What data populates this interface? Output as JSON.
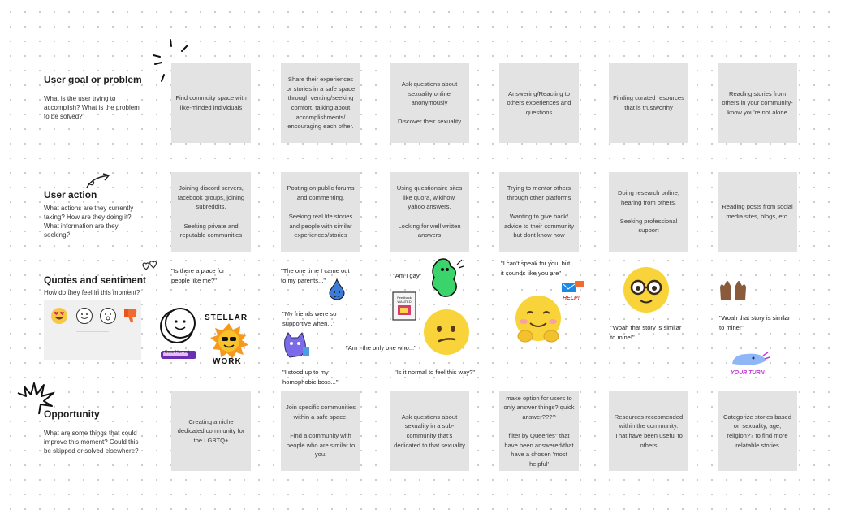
{
  "rows": {
    "goal": {
      "title": "User goal or problem",
      "desc": "What is the user trying to accomplish? What is the problem to be solved?"
    },
    "action": {
      "title": "User action",
      "desc": "What actions are they currently taking? How are they doing it? What information are they seeking?"
    },
    "quotes": {
      "title": "Quotes and sentiment",
      "desc": "How do they feel in this moment?"
    },
    "opportunity": {
      "title": "Opportunity",
      "desc": "What are some things that could improve this moment? Could this be skipped or solved elsewhere?"
    }
  },
  "goal_cards": [
    "Find commuity space with like-minded individuals",
    "Share their experiences or stories in a safe space through venting/seeking comfort, talking about accomplishments/ encouraging each other.",
    "Ask questions about sexuality online anonymously\n\nDiscover their sexuality",
    "Answering/Reacting to others experiences and questions",
    "Finding curated resources that is trustworthy",
    "Reading stories from others in your community- know you're not alone"
  ],
  "action_cards": [
    "Joining discord servers, facebook groups, joining subreddits.\n\nSeeking private and reputable communities",
    "Posting on public forums and commenting.\n\nSeeking real life stories and people with similar experiences/stories",
    "Using questionaire sites like quora, wikihow, yahoo answers.\n\nLooking for well written answers",
    "Trying to mentor others through other platforms\n\nWanting to give back/ advice to their community but dont know how",
    "Doing research online, hearing from others,\n\nSeeking professional support",
    "Reading posts from social media sites, blogs, etc."
  ],
  "opportunity_cards": [
    "Creating a niche dedicated community for the LGBTQ+",
    "Join specific communities within a safe space.\n\nFind a community with people who are similar to you.",
    "Ask questions about sexuality in a sub-community that's dedicated to that sexuality",
    "make option for users to only answer things? quick answer????\n\nfilter by Queeries'' that have been answered/that have a chosen 'most helpful'",
    "Resources reccomended within the community. That have been useful to others",
    "Categorize stories based on sexuality, age, religion?? to find more relatable stories"
  ],
  "quotes": {
    "q1": "\"Is there a place for\npeople like me?\"",
    "q2": "\"The one time I came out\nto my parents...\"",
    "q3": "\"My friends were so\nsupportive when...\"",
    "q4": "\"I stood up to my\nhomophobic boss...\"",
    "q5": "\"Am I gay\"",
    "q6": "\"Am I the only one who...\"",
    "q7": "\"Is it normal to feel this way?\"",
    "q8": "\"I can't speak for you, but\nit sounds like you are\"",
    "q9": "\"Woah that story is similar\nto mine!\"",
    "q10": "\"Woah that story is similar\nto mine!\""
  },
  "stickers": {
    "stellar": "STELLAR",
    "work": "WORK",
    "help": "HELP!",
    "your_turn": "YOUR TURN",
    "solar": "Solar Harvest",
    "feedback": "Feedback WANTED"
  }
}
